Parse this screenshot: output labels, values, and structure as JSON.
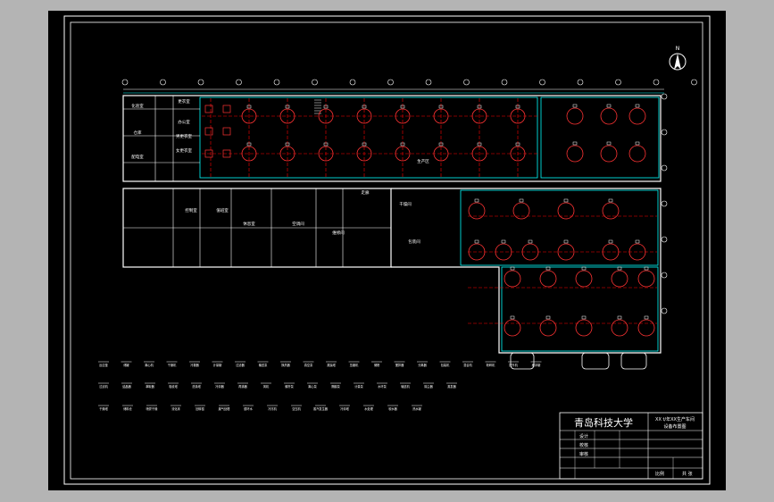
{
  "colors": {
    "background": "#b4b4b4",
    "sheet": "#000000",
    "lines": "#ffffff",
    "walls": "#00ffff",
    "axes": "#ff0000",
    "equipment": "#ff3333"
  },
  "north_arrow": {
    "label": "N"
  },
  "title_block": {
    "university": "青岛科技大学",
    "drawing_title_line1": "XX t/年XX生产车间",
    "drawing_title_line2": "设备布置图",
    "rows": [
      "设计",
      "校核",
      "审核"
    ],
    "footer_left": "比例",
    "footer_right": "共 张"
  },
  "room_labels": [
    "化验室",
    "更衣室",
    "办公室",
    "男更衣室",
    "女更衣室",
    "仓库",
    "配电室",
    "控制室",
    "值班室",
    "休息室",
    "空调间",
    "维修间",
    "走廊",
    "生产区",
    "干燥间",
    "包装间"
  ],
  "legend": {
    "row1": [
      "反应釜",
      "储罐",
      "离心机",
      "干燥机",
      "冷凝器",
      "计量罐",
      "过滤器",
      "输送泵",
      "换热器",
      "真空泵",
      "蒸馏塔",
      "压缩机",
      "储槽",
      "搅拌器",
      "分离器",
      "包装机",
      "混合机",
      "粉碎机",
      "提升机",
      "缓冲罐"
    ],
    "row2": [
      "过滤机",
      "结晶器",
      "萃取器",
      "吸收塔",
      "洗涤塔",
      "冷却器",
      "再沸器",
      "风机",
      "螺杆泵",
      "离心泵",
      "隔膜泵",
      "计量泵",
      "水环泵",
      "输送机",
      "除尘器",
      "蒸发器"
    ],
    "row3": [
      "干燥塔",
      "储料仓",
      "喷雾干燥",
      "流化床",
      "回转窑",
      "废气处理",
      "循环水",
      "冷冻机",
      "空压机",
      "蒸汽发生器",
      "冷却塔",
      "水处理",
      "软水器",
      "热水罐"
    ]
  }
}
